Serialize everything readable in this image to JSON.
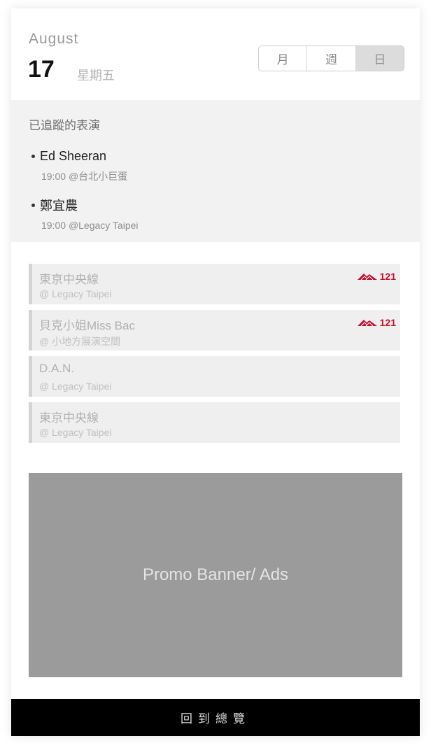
{
  "header": {
    "month": "August",
    "day": "17",
    "weekday": "星期五",
    "views": [
      "月",
      "週",
      "日"
    ],
    "active_view": "日"
  },
  "tracked": {
    "title": "已追蹤的表演",
    "items": [
      {
        "name": "Ed Sheeran",
        "time": "19:00",
        "venue": "@台北小巨蛋"
      },
      {
        "name": "鄭宜農",
        "time": "19:00",
        "venue": "@Legacy Taipei"
      }
    ]
  },
  "events": [
    {
      "title": "東京中央線",
      "venue": "@ Legacy Taipei",
      "hot_count": "121"
    },
    {
      "title": "貝克小姐Miss Bac",
      "venue": "@ 小地方展演空間",
      "hot_count": "121"
    },
    {
      "title": "D.A.N.",
      "venue": "@ Legacy Taipei"
    },
    {
      "title": "東京中央線",
      "venue": "@ Legacy Taipei"
    }
  ],
  "promo": {
    "label": "Promo Banner/ Ads"
  },
  "footer": {
    "back_label": "回到總覽"
  },
  "colors": {
    "accent": "#c4122f",
    "bottom_bar": "#000000",
    "tracked_bg": "#f2f2f2",
    "promo_bg": "#9b9b9b"
  },
  "icons": {
    "hot": "mountain-icon"
  }
}
